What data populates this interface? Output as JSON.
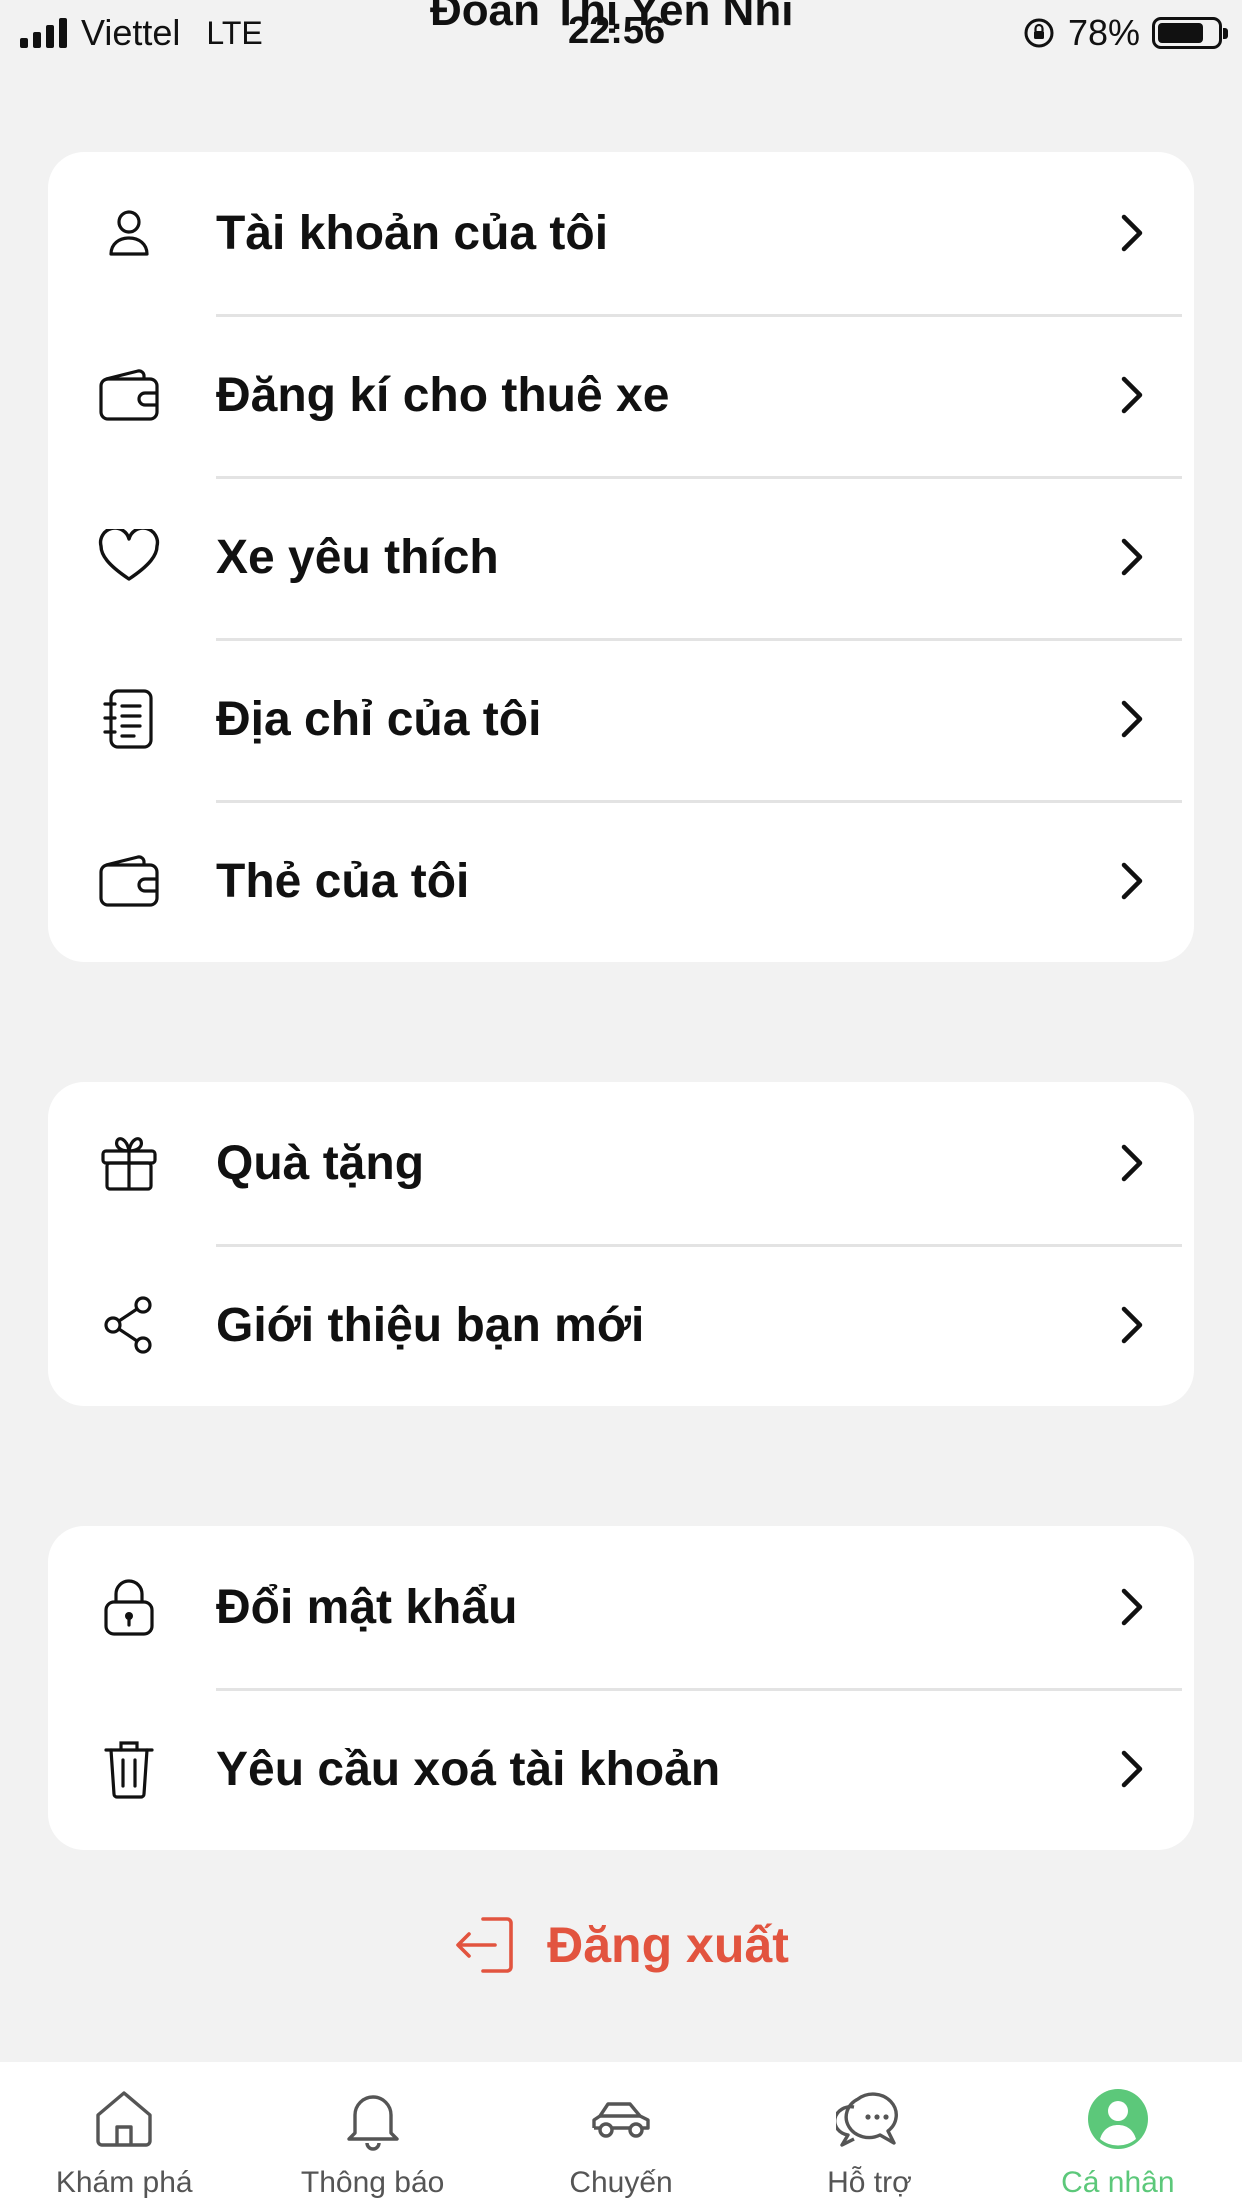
{
  "status_bar": {
    "carrier": "Viettel",
    "network": "LTE",
    "title": "Đoàn Thị Yến Nhi",
    "time": "22:56",
    "battery": "78%"
  },
  "groups": [
    {
      "items": [
        {
          "label": "Tài khoản của tôi",
          "icon": "user-icon"
        },
        {
          "label": "Đăng kí cho thuê xe",
          "icon": "wallet-icon"
        },
        {
          "label": "Xe yêu thích",
          "icon": "heart-icon"
        },
        {
          "label": "Địa chỉ của tôi",
          "icon": "address-book-icon"
        },
        {
          "label": "Thẻ của tôi",
          "icon": "wallet-icon"
        }
      ]
    },
    {
      "items": [
        {
          "label": "Quà tặng",
          "icon": "gift-icon"
        },
        {
          "label": "Giới thiệu bạn mới",
          "icon": "share-icon"
        }
      ]
    },
    {
      "items": [
        {
          "label": "Đổi mật khẩu",
          "icon": "lock-icon"
        },
        {
          "label": "Yêu cầu xoá tài khoản",
          "icon": "trash-icon"
        }
      ]
    }
  ],
  "logout": {
    "label": "Đăng xuất",
    "color": "#e2543f"
  },
  "bottom_nav": {
    "active_color": "#5cc87a",
    "items": [
      {
        "label": "Khám phá",
        "icon": "home-icon"
      },
      {
        "label": "Thông báo",
        "icon": "bell-icon"
      },
      {
        "label": "Chuyến",
        "icon": "car-icon"
      },
      {
        "label": "Hỗ trợ",
        "icon": "chat-icon"
      },
      {
        "label": "Cá nhân",
        "icon": "profile-icon",
        "active": true
      }
    ]
  }
}
